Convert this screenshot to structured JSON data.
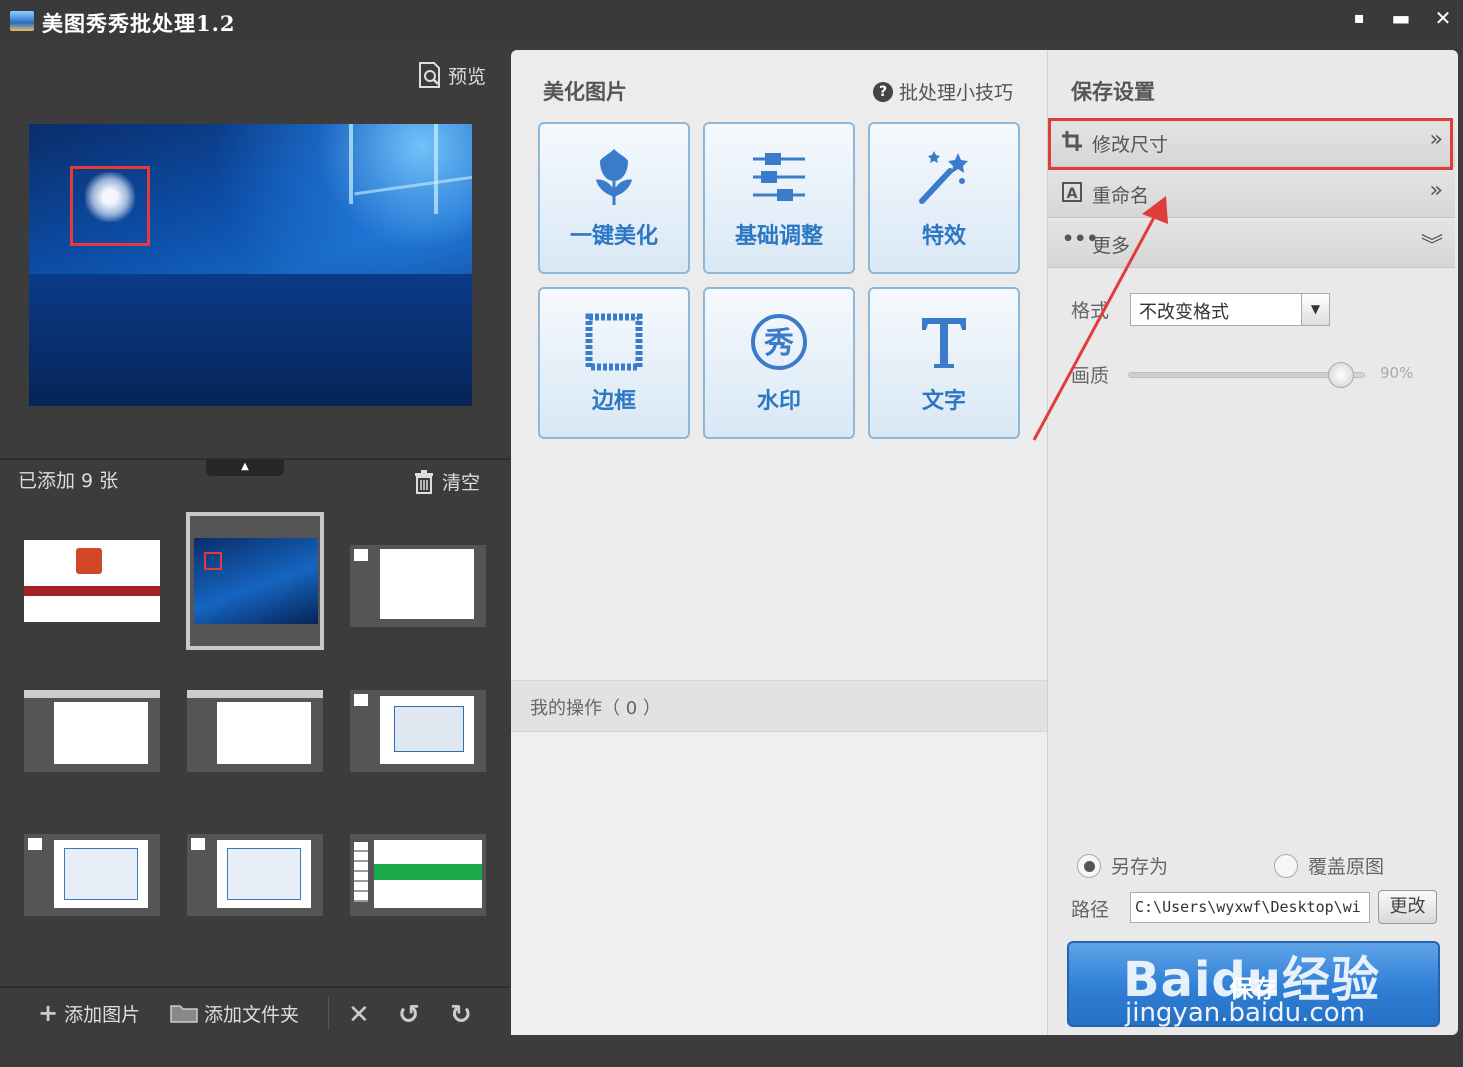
{
  "window": {
    "title": "美图秀秀批处理1.2",
    "controls": [
      "chat-icon",
      "minimize-icon",
      "close-icon"
    ]
  },
  "left": {
    "preview_label": "预览",
    "added_label": "已添加 9 张",
    "clear_label": "清空",
    "thumbnails": [
      {
        "kind": "ppt"
      },
      {
        "kind": "desktop",
        "selected": true
      },
      {
        "kind": "doc"
      },
      {
        "kind": "doc"
      },
      {
        "kind": "doc"
      },
      {
        "kind": "dialog"
      },
      {
        "kind": "dialog"
      },
      {
        "kind": "dialog"
      },
      {
        "kind": "web"
      }
    ],
    "toolbar": {
      "add_image": "添加图片",
      "add_folder": "添加文件夹"
    }
  },
  "middle": {
    "section_title": "美化图片",
    "tips_label": "批处理小技巧",
    "tiles": [
      {
        "label": "一键美化",
        "icon": "tulip-icon"
      },
      {
        "label": "基础调整",
        "icon": "sliders-icon"
      },
      {
        "label": "特效",
        "icon": "magic-wand-icon"
      },
      {
        "label": "边框",
        "icon": "frame-icon"
      },
      {
        "label": "水印",
        "icon": "watermark-icon"
      },
      {
        "label": "文字",
        "icon": "text-icon"
      }
    ],
    "ops_label": "我的操作（ 0 ）"
  },
  "right": {
    "section_title": "保存设置",
    "rows": [
      {
        "label": "修改尺寸",
        "icon": "crop-icon",
        "arrow": "»"
      },
      {
        "label": "重命名",
        "icon": "rename-icon",
        "arrow": "»"
      },
      {
        "label": "更多",
        "icon": "more-icon",
        "arrow": "︾"
      }
    ],
    "format_label": "格式",
    "format_value": "不改变格式",
    "quality_label": "画质",
    "quality_value": "90%",
    "quality_percent": 90,
    "save_as_label": "另存为",
    "overwrite_label": "覆盖原图",
    "path_label": "路径",
    "path_value": "C:\\Users\\wyxwf\\Desktop\\wi",
    "change_label": "更改",
    "save_label": "保存"
  },
  "watermark": {
    "text": "Baidu经验",
    "url": "jingyan.baidu.com"
  },
  "colors": {
    "highlight": "#e03c3c",
    "accent": "#2c77c3",
    "save": "#2f7fd6"
  }
}
